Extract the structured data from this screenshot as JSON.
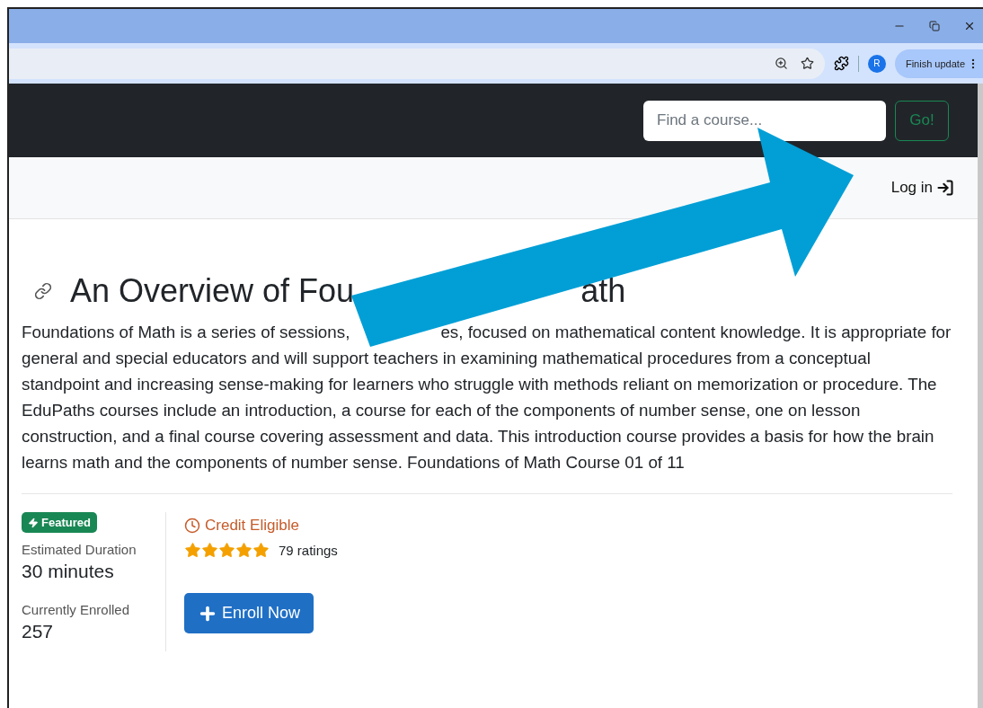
{
  "browser": {
    "profile_initial": "R",
    "update_button": "Finish update"
  },
  "site": {
    "search": {
      "placeholder": "Find a course..."
    },
    "search_button": "Go!",
    "login": "Log in"
  },
  "course": {
    "title_parts": [
      "An Overview of Fou",
      "ath"
    ],
    "description_first_line_parts": [
      "Foundations of Math is a series of sessions,",
      "es, focused on mathematical content knowledge. It is appropriate for"
    ],
    "description_lines": [
      "general and special educators and will support teachers in examining mathematical procedures from a conceptual",
      "standpoint and increasing sense-making for learners who struggle with methods reliant on memorization or procedure. The",
      "EduPaths courses include an introduction, a course for each of the components of number sense, one on lesson",
      "construction, and a final course covering assessment and data. This introduction course provides a basis for how the brain",
      "learns math and the components of number sense. Foundations of Math Course 01 of 11"
    ],
    "badge": "Featured",
    "duration_label": "Estimated Duration",
    "duration": "30 minutes",
    "enrolled_label": "Currently Enrolled",
    "enrolled": "257",
    "credit": "Credit Eligible",
    "stars": 5,
    "ratings": "79 ratings",
    "enroll_button": "Enroll Now"
  }
}
